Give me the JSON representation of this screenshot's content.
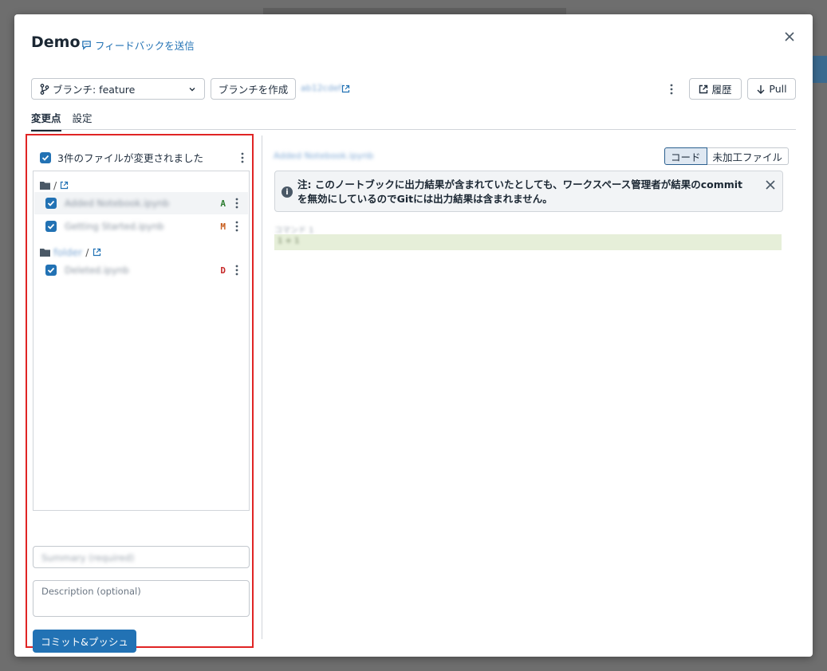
{
  "dialog": {
    "title": "Demo",
    "feedback_link": "フィードバックを送信"
  },
  "toolbar": {
    "branch_label": "ブランチ: feature",
    "create_branch": "ブランチを作成",
    "commit_ref": "ab12cdef",
    "history": "履歴",
    "pull": "Pull"
  },
  "tabs": [
    {
      "label": "変更点",
      "active": true
    },
    {
      "label": "設定",
      "active": false
    }
  ],
  "changes": {
    "summary_header": "3件のファイルが変更されました",
    "groups": [
      {
        "path_prefix": "",
        "path_sep": "/",
        "files": [
          {
            "name": "Added Notebook.ipynb",
            "status": "A",
            "status_color": "#2e7d32",
            "selected": true
          },
          {
            "name": "Getting Started.ipynb",
            "status": "M",
            "status_color": "#c75b1a",
            "selected": false
          }
        ]
      },
      {
        "path_prefix": "folder",
        "path_sep": "/",
        "files": [
          {
            "name": "Deleted.ipynb",
            "status": "D",
            "status_color": "#c62828",
            "selected": false
          }
        ]
      }
    ],
    "summary_placeholder": "Summary (required)",
    "description_placeholder": "Description (optional)",
    "commit_button": "コミット&プッシュ"
  },
  "diff": {
    "file_title": "Added Notebook.ipynb",
    "view_toggle": [
      "コード",
      "未加工ファイル"
    ],
    "notice": "注:  このノートブックに出力結果が含まれていたとしても、ワークスペース管理者が結果のcommitを無効にしているのでGitには出力結果は含まれません。",
    "cell_label": "コマンド 1",
    "cell_line": "1 + 1"
  },
  "colors": {
    "accent": "#2272b4",
    "highlight_frame": "#e02424"
  }
}
